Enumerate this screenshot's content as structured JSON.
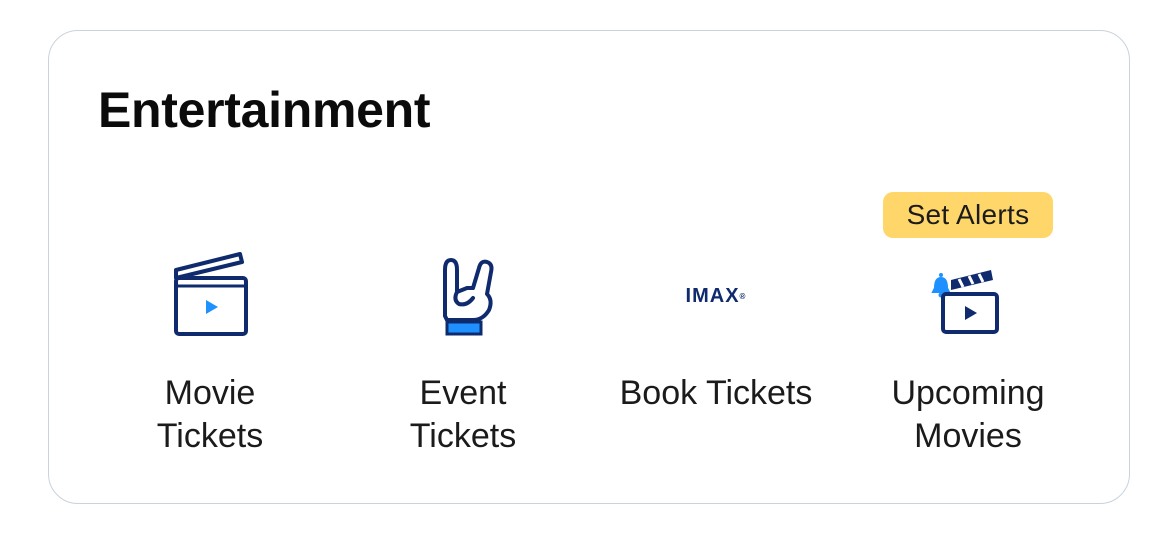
{
  "section": {
    "title": "Entertainment"
  },
  "tiles": [
    {
      "line1": "Movie",
      "line2": "Tickets",
      "icon": "clapperboard-play-icon"
    },
    {
      "line1": "Event",
      "line2": "Tickets",
      "icon": "rock-hand-icon"
    },
    {
      "line1": "Book Tickets",
      "line2": "",
      "icon": "imax-logo",
      "logo_text": "IMAX"
    },
    {
      "line1": "Upcoming",
      "line2": "Movies",
      "icon": "clapperboard-bell-icon",
      "badge": "Set Alerts"
    }
  ],
  "colors": {
    "icon_navy": "#0f2b6e",
    "icon_accent": "#1e90ff",
    "badge_bg": "#ffd669",
    "border": "#c9d3dc"
  }
}
